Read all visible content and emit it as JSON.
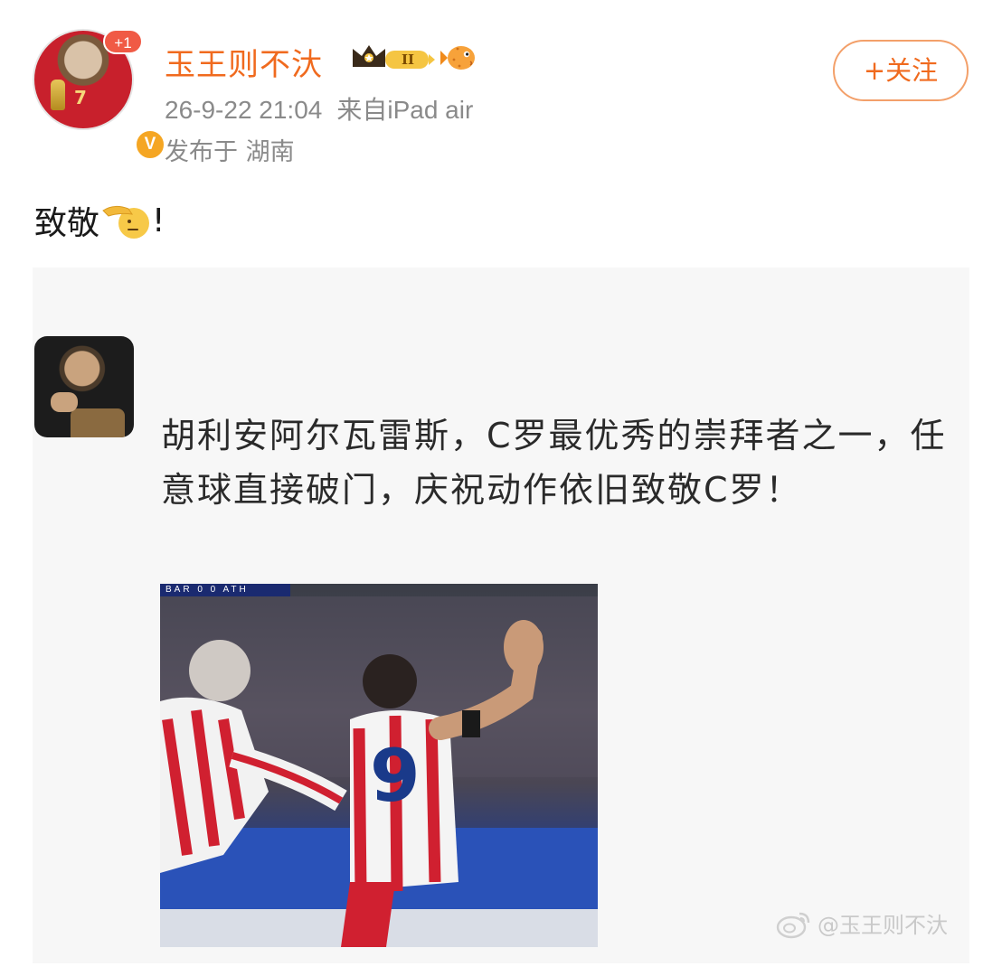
{
  "post": {
    "author": {
      "name": "玉王则不汏",
      "notification_badge": "+1",
      "verified_badge": "V"
    },
    "timestamp": "26-9-22 21:04",
    "source": "来自iPad air",
    "location": "发布于 湖南",
    "follow_label": "+关注",
    "text_before": "致敬",
    "text_after": "!",
    "emoji": "salute-emoji"
  },
  "image": {
    "caption": "胡利安阿尔瓦雷斯，C罗最优秀的崇拜者之一，任意球直接破门，庆祝动作依旧致敬C罗！",
    "scoreboard": "BAR 0 0 ATH",
    "watermark": "@玉王则不汏"
  },
  "colors": {
    "accent": "#f06a1e",
    "meta_text": "#8a8a8a",
    "badge_red": "#f05a45",
    "verified_orange": "#f5a623"
  }
}
